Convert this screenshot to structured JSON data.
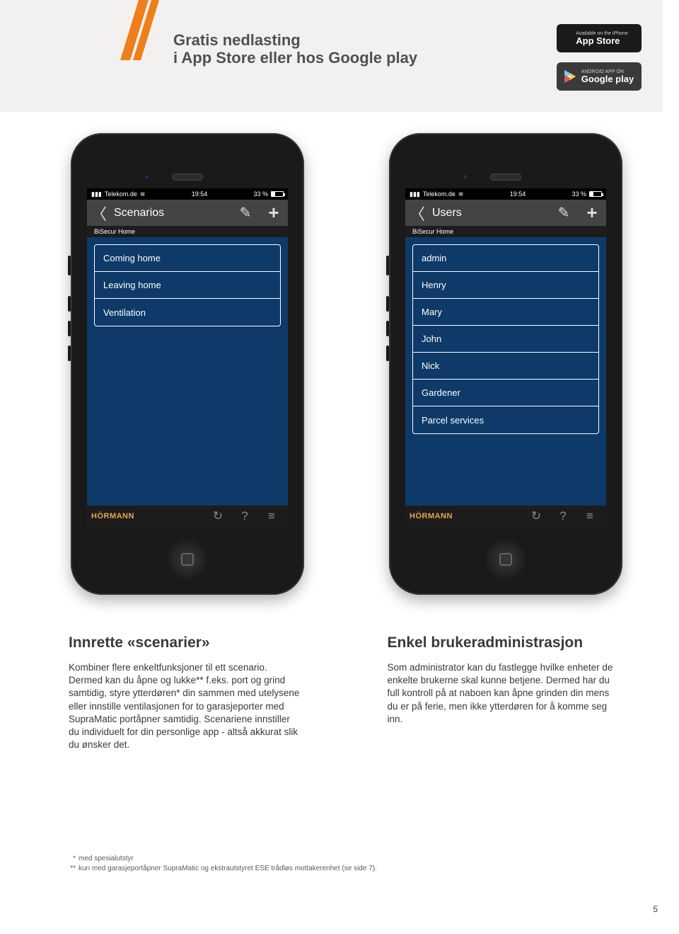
{
  "header": {
    "title_line1": "Gratis nedlasting",
    "title_line2": "i App Store eller hos Google play"
  },
  "badges": {
    "appstore": {
      "small": "Available on the iPhone",
      "big": "App Store"
    },
    "googleplay": {
      "small": "ANDROID APP ON",
      "big": "Google play"
    }
  },
  "phone1": {
    "status": {
      "carrier": "Telekom.de",
      "time": "19:54",
      "battery": "33 %"
    },
    "nav_title": "Scenarios",
    "subhead": "BiSecur Home",
    "items": [
      "Coming home",
      "Leaving home",
      "Ventilation"
    ],
    "logo": "HÖRMANN"
  },
  "phone2": {
    "status": {
      "carrier": "Telekom.de",
      "time": "19:54",
      "battery": "33 %"
    },
    "nav_title": "Users",
    "subhead": "BiSecur Home",
    "items": [
      "admin",
      "Henry",
      "Mary",
      "John",
      "Nick",
      "Gardener",
      "Parcel services"
    ],
    "logo": "HÖRMANN"
  },
  "columns": {
    "left": {
      "title": "Innrette «scenarier»",
      "body": "Kombiner flere enkeltfunksjoner til ett scenario. Dermed kan du åpne og lukke** f.eks. port og grind samtidig, styre ytterdøren* din sammen med utelysene eller innstille ventilasjonen for to garasjeporter med SupraMatic portåpner samtidig. Scenariene innstiller du individuelt for din personlige app - altså akkurat slik du ønsker det."
    },
    "right": {
      "title": "Enkel brukeradministrasjon",
      "body": "Som administrator kan du fastlegge hvilke enheter de enkelte brukerne skal kunne betjene. Dermed har du full kontroll på at naboen kan åpne grinden din mens du er på ferie, men ikke ytterdøren for å komme seg inn."
    }
  },
  "footnotes": {
    "f1_mark": "*",
    "f1_text": "med spesialutstyr",
    "f2_mark": "**",
    "f2_text": "kun med garasjeportåpner SupraMatic og ekstrautstyret ESE trådløs mottakerenhet (se side 7)."
  },
  "page_number": "5"
}
